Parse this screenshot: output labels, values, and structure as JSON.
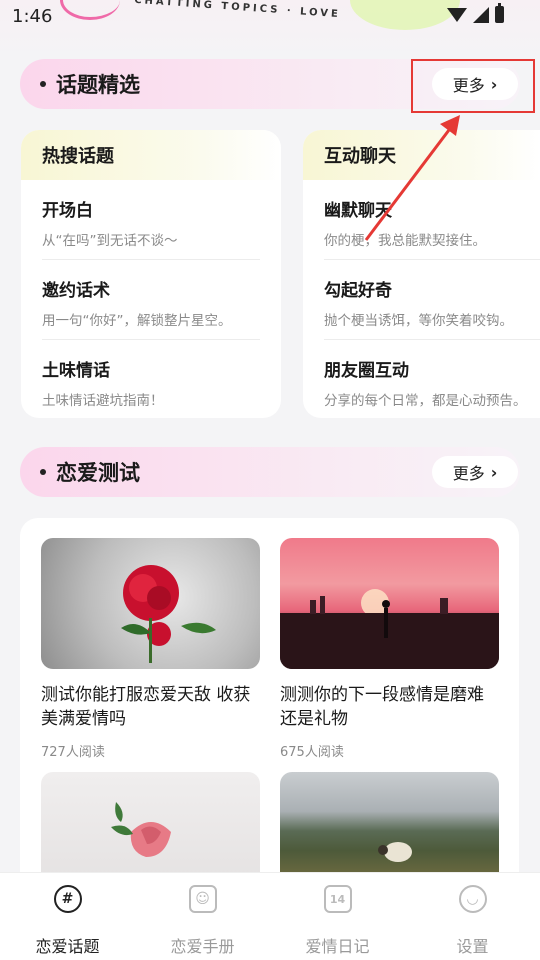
{
  "status_bar": {
    "time": "1:46"
  },
  "header": {
    "deco_text": "CHATTING TOPICS · LOVE"
  },
  "topics_section": {
    "title": "话题精选",
    "more_label": "更多",
    "cards": [
      {
        "title": "热搜话题",
        "items": [
          {
            "title": "开场白",
            "subtitle": "从“在吗”到无话不谈～"
          },
          {
            "title": "邀约话术",
            "subtitle": "用一句“你好”，解锁整片星空。"
          },
          {
            "title": "土味情话",
            "subtitle": "土味情话避坑指南！"
          }
        ]
      },
      {
        "title": "互动聊天",
        "items": [
          {
            "title": "幽默聊天",
            "subtitle": "你的梗，我总能默契接住。"
          },
          {
            "title": "勾起好奇",
            "subtitle": "抛个梗当诱饵，等你笑着咬钩。"
          },
          {
            "title": "朋友圈互动",
            "subtitle": "分享的每个日常，都是心动预告。"
          }
        ]
      }
    ]
  },
  "test_section": {
    "title": "恋爱测试",
    "more_label": "更多",
    "items": [
      {
        "title": "测试你能打服恋爱天敌  收获美满爱情吗",
        "reads": "727人阅读"
      },
      {
        "title": "测测你的下一段感情是磨难还是礼物",
        "reads": "675人阅读"
      }
    ]
  },
  "tabbar": {
    "tabs": [
      {
        "label": "恋爱话题",
        "icon": "#"
      },
      {
        "label": "恋爱手册",
        "icon": "☺"
      },
      {
        "label": "爱情日记",
        "icon": "14"
      },
      {
        "label": "设置",
        "icon": "◡"
      }
    ]
  }
}
